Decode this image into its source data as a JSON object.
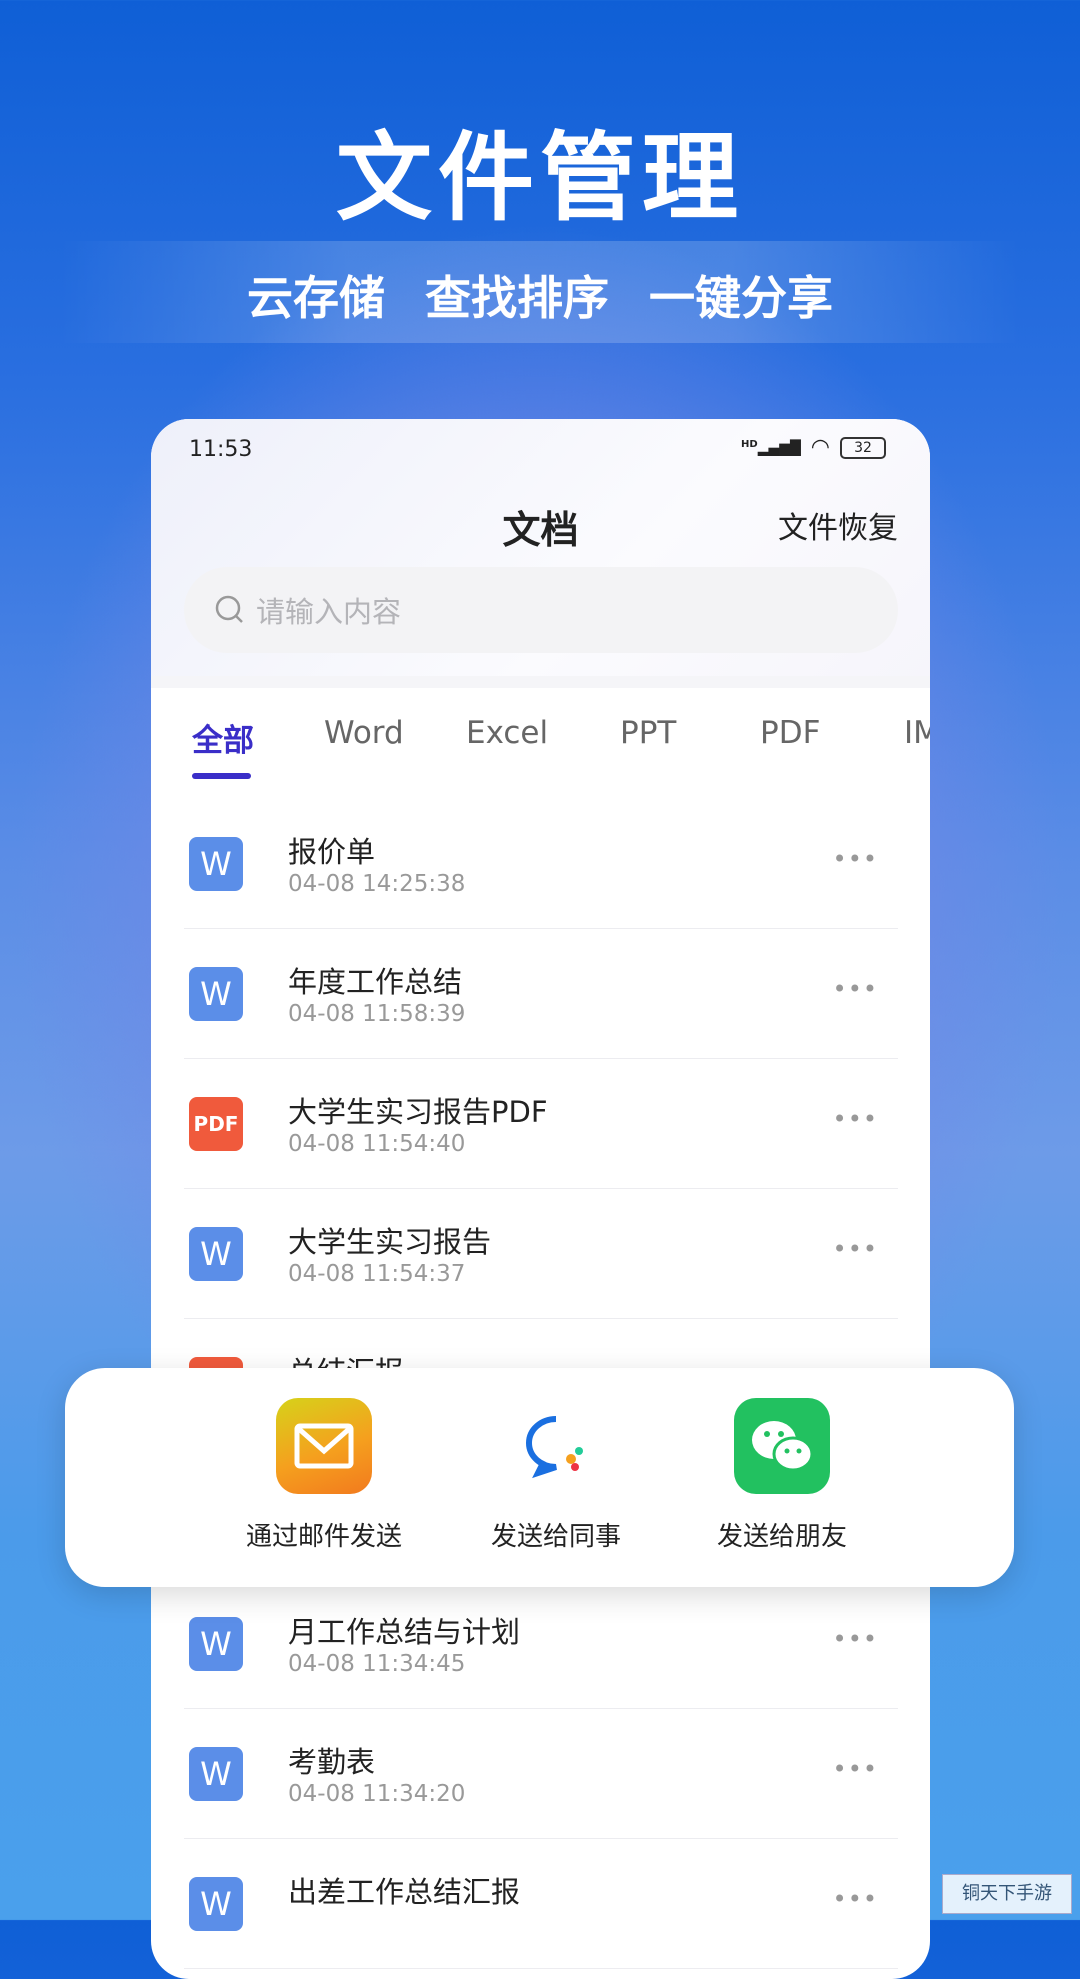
{
  "hero": {
    "title": "文件管理",
    "features": [
      "云存储",
      "查找排序",
      "一键分享"
    ]
  },
  "status_bar": {
    "time": "11:53",
    "network": "HD",
    "battery": "32"
  },
  "header": {
    "title": "文档",
    "restore_label": "文件恢复"
  },
  "search": {
    "placeholder": "请输入内容"
  },
  "tabs": [
    {
      "label": "全部",
      "active": true
    },
    {
      "label": "Word"
    },
    {
      "label": "Excel"
    },
    {
      "label": "PPT"
    },
    {
      "label": "PDF"
    },
    {
      "label": "IM"
    }
  ],
  "files": [
    {
      "name": "报价单",
      "date": "04-08 14:25:38",
      "type": "W"
    },
    {
      "name": "年度工作总结",
      "date": "04-08 11:58:39",
      "type": "W"
    },
    {
      "name": "大学生实习报告PDF",
      "date": "04-08 11:54:40",
      "type": "PDF"
    },
    {
      "name": "大学生实习报告",
      "date": "04-08 11:54:37",
      "type": "W"
    },
    {
      "name": "总结汇报",
      "date": "",
      "type": "P"
    },
    {
      "name": "月工作总结与计划",
      "date": "04-08 11:34:45",
      "type": "W"
    },
    {
      "name": "考勤表",
      "date": "04-08 11:34:20",
      "type": "W"
    },
    {
      "name": "出差工作总结汇报",
      "date": "",
      "type": "W"
    }
  ],
  "share": [
    {
      "label": "通过邮件发送",
      "icon": "mail-icon"
    },
    {
      "label": "发送给同事",
      "icon": "dingtalk-chat-icon"
    },
    {
      "label": "发送给朋友",
      "icon": "wechat-icon"
    }
  ],
  "more_label": "•••",
  "watermark": "铜天下手游",
  "colors": {
    "accent": "#3a2ec8",
    "word": "#5b8ee8",
    "pdf": "#f05a3c",
    "wechat": "#22c160"
  }
}
